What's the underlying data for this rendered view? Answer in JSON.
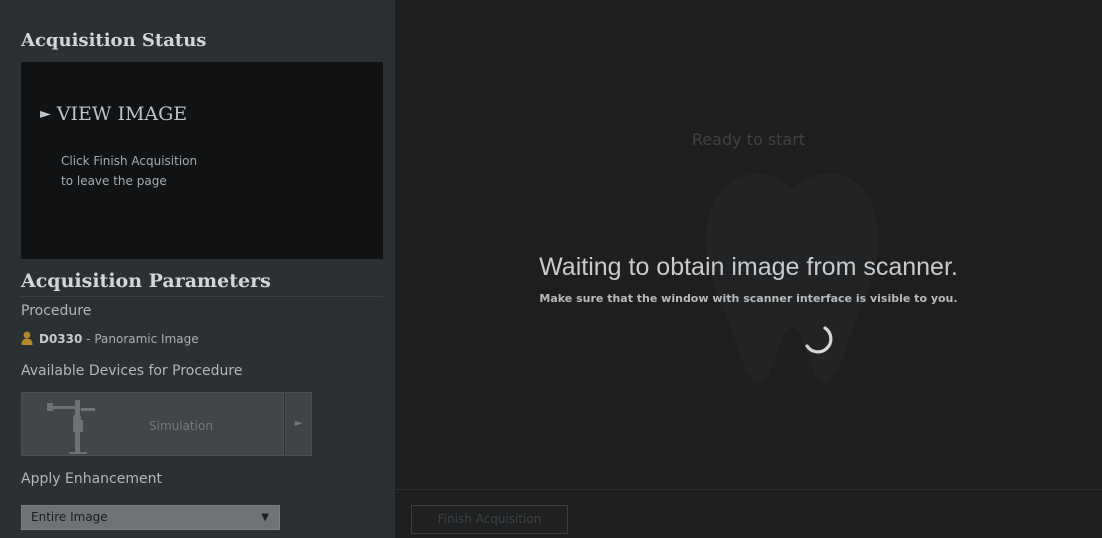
{
  "status": {
    "title": "Acquisition Status",
    "view_image": "VIEW IMAGE",
    "hint_line1": "Click Finish Acquisition",
    "hint_line2": "to leave the page"
  },
  "parameters": {
    "title": "Acquisition Parameters",
    "procedure_label": "Procedure",
    "procedure_code": "D0330",
    "procedure_name": " - Panoramic Image",
    "devices_label": "Available Devices for Procedure",
    "device_name": "Simulation",
    "enhancement_label": "Apply Enhancement",
    "enhancement_value": "Entire Image"
  },
  "scanner": {
    "ready": "Ready to start",
    "waiting": "Waiting to obtain image from scanner.",
    "make_sure": "Make sure that the window with scanner interface is visible to you.",
    "finish_button": "Finish Acquisition"
  },
  "icons": {
    "view_arrow": "play-arrow-icon",
    "procedure": "person-icon",
    "device_next": "chevron-right-icon",
    "enhancement_caret": "caret-down-icon",
    "spinner": "loading-spinner-icon"
  },
  "colors": {
    "procedure_icon": "#b4892e"
  }
}
